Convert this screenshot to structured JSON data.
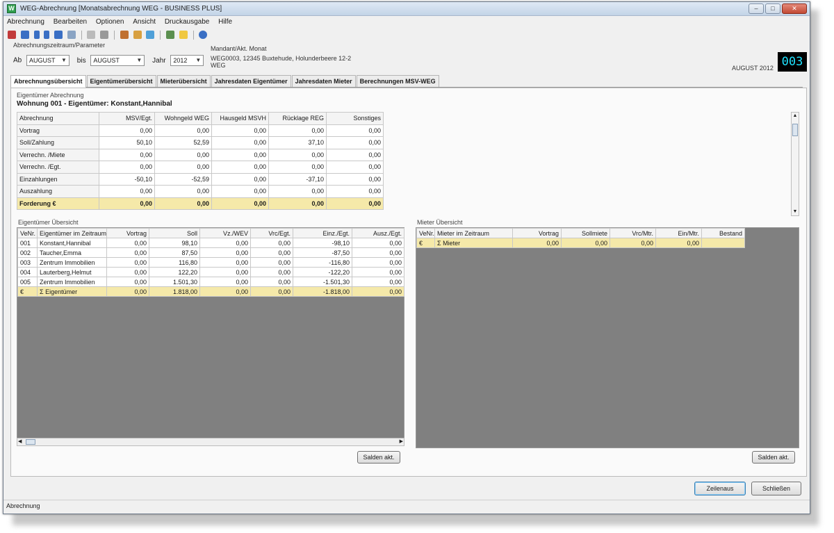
{
  "window": {
    "title": "WEG-Abrechnung [Monatsabrechnung WEG - BUSINESS PLUS]",
    "app_icon": "W"
  },
  "menu": [
    "Abrechnung",
    "Bearbeiten",
    "Optionen",
    "Ansicht",
    "Druckausgabe",
    "Hilfe"
  ],
  "params": {
    "group_label": "Abrechnungszeitraum/Parameter",
    "from_label": "Ab",
    "from_value": "AUGUST",
    "to_label": "bis",
    "to_value": "AUGUST",
    "year_label": "Jahr",
    "year_value": "2012"
  },
  "mandant": {
    "label": "Mandant/Akt. Monat",
    "address": "WEG0003, 12345 Buxtehude, Holunderbeere 12-2",
    "type": "WEG"
  },
  "period_text": "AUGUST 2012",
  "mandant_no": "003",
  "tabs": [
    "Abrechnungsübersicht",
    "Eigentümerübersicht",
    "Mieterübersicht",
    "Jahresdaten Eigentümer",
    "Jahresdaten Mieter",
    "Berechnungen MSV-WEG"
  ],
  "owner_detail": {
    "section_label": "Eigentümer Abrechnung",
    "title": "Wohnung 001 - Eigentümer: Konstant,Hannibal",
    "headers": [
      "Abrechnung",
      "MSV/Egt.",
      "Wohngeld WEG",
      "Hausgeld MSVH",
      "Rücklage REG",
      "Sonstiges"
    ],
    "rows": [
      [
        "Vortrag",
        "0,00",
        "0,00",
        "0,00",
        "0,00",
        "0,00"
      ],
      [
        "Soll/Zahlung",
        "50,10",
        "52,59",
        "0,00",
        "37,10",
        "0,00"
      ],
      [
        "Verrechn. /Miete",
        "0,00",
        "0,00",
        "0,00",
        "0,00",
        "0,00"
      ],
      [
        "Verrechn. /Egt.",
        "0,00",
        "0,00",
        "0,00",
        "0,00",
        "0,00"
      ],
      [
        "Einzahlungen",
        "-50,10",
        "-52,59",
        "0,00",
        "-37,10",
        "0,00"
      ],
      [
        "Auszahlung",
        "0,00",
        "0,00",
        "0,00",
        "0,00",
        "0,00"
      ]
    ],
    "sum_row": [
      "Forderung €",
      "0,00",
      "0,00",
      "0,00",
      "0,00",
      "0,00"
    ]
  },
  "owners": {
    "section_label": "Eigentümer Übersicht",
    "headers": [
      "VeNr.",
      "Eigentümer im Zeitraum",
      "Vortrag",
      "Soll",
      "Vz./WEV",
      "Vrc/Egt.",
      "Einz./Egt.",
      "Ausz./Egt."
    ],
    "rows": [
      [
        "001",
        "Konstant,Hannibal",
        "0,00",
        "98,10",
        "0,00",
        "0,00",
        "-98,10",
        "0,00"
      ],
      [
        "002",
        "Taucher,Emma",
        "0,00",
        "87,50",
        "0,00",
        "0,00",
        "-87,50",
        "0,00"
      ],
      [
        "003",
        "Zentrum Immobilien",
        "0,00",
        "116,80",
        "0,00",
        "0,00",
        "-116,80",
        "0,00"
      ],
      [
        "004",
        "Lauterberg,Helmut",
        "0,00",
        "122,20",
        "0,00",
        "0,00",
        "-122,20",
        "0,00"
      ],
      [
        "005",
        "Zentrum Immobilien",
        "0,00",
        "1.501,30",
        "0,00",
        "0,00",
        "-1.501,30",
        "0,00"
      ]
    ],
    "sum_row": [
      "€",
      "Σ Eigentümer",
      "0,00",
      "1.818,00",
      "0,00",
      "0,00",
      "-1.818,00",
      "0,00"
    ],
    "button": "Salden akt."
  },
  "tenants": {
    "section_label": "Mieter Übersicht",
    "headers": [
      "VeNr.",
      "Mieter im Zeitraum",
      "Vortrag",
      "Sollmiete",
      "Vrc/Mtr.",
      "Ein/Mtr.",
      "Bestand"
    ],
    "sum_row": [
      "€",
      "Σ Mieter",
      "0,00",
      "0,00",
      "0,00",
      "0,00",
      ""
    ],
    "button": "Salden akt."
  },
  "footer": {
    "ok": "Zeilenaus",
    "close": "Schließen"
  },
  "status": "Abrechnung",
  "colors": {
    "sum_row": "#f5e9a9",
    "badge_text": "#1fe3ff"
  }
}
